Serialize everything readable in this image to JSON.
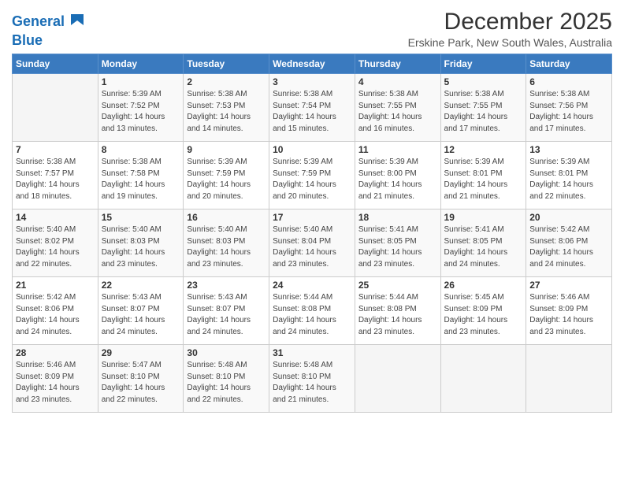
{
  "header": {
    "logo_line1": "General",
    "logo_line2": "Blue",
    "title": "December 2025",
    "subtitle": "Erskine Park, New South Wales, Australia"
  },
  "days_of_week": [
    "Sunday",
    "Monday",
    "Tuesday",
    "Wednesday",
    "Thursday",
    "Friday",
    "Saturday"
  ],
  "weeks": [
    [
      {
        "day": "",
        "info": ""
      },
      {
        "day": "1",
        "info": "Sunrise: 5:39 AM\nSunset: 7:52 PM\nDaylight: 14 hours\nand 13 minutes."
      },
      {
        "day": "2",
        "info": "Sunrise: 5:38 AM\nSunset: 7:53 PM\nDaylight: 14 hours\nand 14 minutes."
      },
      {
        "day": "3",
        "info": "Sunrise: 5:38 AM\nSunset: 7:54 PM\nDaylight: 14 hours\nand 15 minutes."
      },
      {
        "day": "4",
        "info": "Sunrise: 5:38 AM\nSunset: 7:55 PM\nDaylight: 14 hours\nand 16 minutes."
      },
      {
        "day": "5",
        "info": "Sunrise: 5:38 AM\nSunset: 7:55 PM\nDaylight: 14 hours\nand 17 minutes."
      },
      {
        "day": "6",
        "info": "Sunrise: 5:38 AM\nSunset: 7:56 PM\nDaylight: 14 hours\nand 17 minutes."
      }
    ],
    [
      {
        "day": "7",
        "info": "Sunrise: 5:38 AM\nSunset: 7:57 PM\nDaylight: 14 hours\nand 18 minutes."
      },
      {
        "day": "8",
        "info": "Sunrise: 5:38 AM\nSunset: 7:58 PM\nDaylight: 14 hours\nand 19 minutes."
      },
      {
        "day": "9",
        "info": "Sunrise: 5:39 AM\nSunset: 7:59 PM\nDaylight: 14 hours\nand 20 minutes."
      },
      {
        "day": "10",
        "info": "Sunrise: 5:39 AM\nSunset: 7:59 PM\nDaylight: 14 hours\nand 20 minutes."
      },
      {
        "day": "11",
        "info": "Sunrise: 5:39 AM\nSunset: 8:00 PM\nDaylight: 14 hours\nand 21 minutes."
      },
      {
        "day": "12",
        "info": "Sunrise: 5:39 AM\nSunset: 8:01 PM\nDaylight: 14 hours\nand 21 minutes."
      },
      {
        "day": "13",
        "info": "Sunrise: 5:39 AM\nSunset: 8:01 PM\nDaylight: 14 hours\nand 22 minutes."
      }
    ],
    [
      {
        "day": "14",
        "info": "Sunrise: 5:40 AM\nSunset: 8:02 PM\nDaylight: 14 hours\nand 22 minutes."
      },
      {
        "day": "15",
        "info": "Sunrise: 5:40 AM\nSunset: 8:03 PM\nDaylight: 14 hours\nand 23 minutes."
      },
      {
        "day": "16",
        "info": "Sunrise: 5:40 AM\nSunset: 8:03 PM\nDaylight: 14 hours\nand 23 minutes."
      },
      {
        "day": "17",
        "info": "Sunrise: 5:40 AM\nSunset: 8:04 PM\nDaylight: 14 hours\nand 23 minutes."
      },
      {
        "day": "18",
        "info": "Sunrise: 5:41 AM\nSunset: 8:05 PM\nDaylight: 14 hours\nand 23 minutes."
      },
      {
        "day": "19",
        "info": "Sunrise: 5:41 AM\nSunset: 8:05 PM\nDaylight: 14 hours\nand 24 minutes."
      },
      {
        "day": "20",
        "info": "Sunrise: 5:42 AM\nSunset: 8:06 PM\nDaylight: 14 hours\nand 24 minutes."
      }
    ],
    [
      {
        "day": "21",
        "info": "Sunrise: 5:42 AM\nSunset: 8:06 PM\nDaylight: 14 hours\nand 24 minutes."
      },
      {
        "day": "22",
        "info": "Sunrise: 5:43 AM\nSunset: 8:07 PM\nDaylight: 14 hours\nand 24 minutes."
      },
      {
        "day": "23",
        "info": "Sunrise: 5:43 AM\nSunset: 8:07 PM\nDaylight: 14 hours\nand 24 minutes."
      },
      {
        "day": "24",
        "info": "Sunrise: 5:44 AM\nSunset: 8:08 PM\nDaylight: 14 hours\nand 24 minutes."
      },
      {
        "day": "25",
        "info": "Sunrise: 5:44 AM\nSunset: 8:08 PM\nDaylight: 14 hours\nand 23 minutes."
      },
      {
        "day": "26",
        "info": "Sunrise: 5:45 AM\nSunset: 8:09 PM\nDaylight: 14 hours\nand 23 minutes."
      },
      {
        "day": "27",
        "info": "Sunrise: 5:46 AM\nSunset: 8:09 PM\nDaylight: 14 hours\nand 23 minutes."
      }
    ],
    [
      {
        "day": "28",
        "info": "Sunrise: 5:46 AM\nSunset: 8:09 PM\nDaylight: 14 hours\nand 23 minutes."
      },
      {
        "day": "29",
        "info": "Sunrise: 5:47 AM\nSunset: 8:10 PM\nDaylight: 14 hours\nand 22 minutes."
      },
      {
        "day": "30",
        "info": "Sunrise: 5:48 AM\nSunset: 8:10 PM\nDaylight: 14 hours\nand 22 minutes."
      },
      {
        "day": "31",
        "info": "Sunrise: 5:48 AM\nSunset: 8:10 PM\nDaylight: 14 hours\nand 21 minutes."
      },
      {
        "day": "",
        "info": ""
      },
      {
        "day": "",
        "info": ""
      },
      {
        "day": "",
        "info": ""
      }
    ]
  ]
}
